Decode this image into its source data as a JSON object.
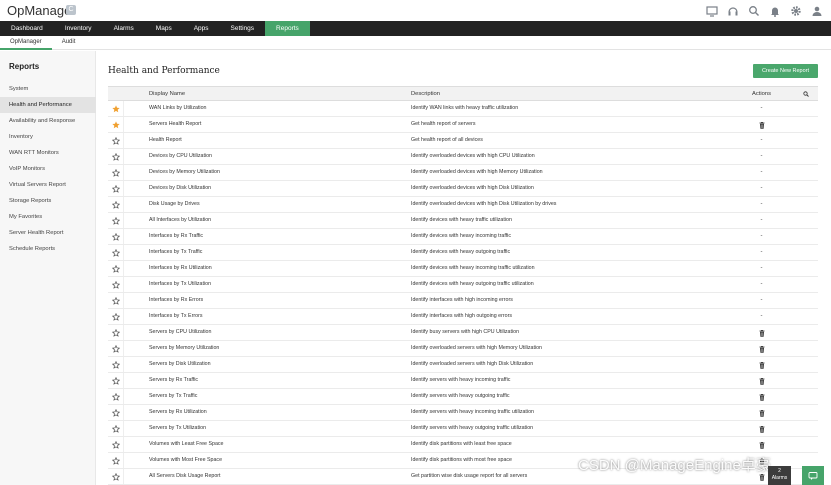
{
  "app": {
    "title": "OpManager",
    "badge": "C"
  },
  "top_icons": [
    "monitor-icon",
    "headset-icon",
    "search-icon",
    "bell-icon",
    "gear-icon",
    "user-icon"
  ],
  "nav": {
    "tabs": [
      {
        "label": "Dashboard",
        "active": false
      },
      {
        "label": "Inventory",
        "active": false
      },
      {
        "label": "Alarms",
        "active": false
      },
      {
        "label": "Maps",
        "active": false
      },
      {
        "label": "Apps",
        "active": false
      },
      {
        "label": "Settings",
        "active": false
      },
      {
        "label": "Reports",
        "active": true
      }
    ]
  },
  "subnav": {
    "tabs": [
      {
        "label": "OpManager",
        "active": true
      },
      {
        "label": "Audit",
        "active": false
      }
    ]
  },
  "sidebar": {
    "title": "Reports",
    "items": [
      {
        "label": "System",
        "active": false
      },
      {
        "label": "Health and Performance",
        "active": true
      },
      {
        "label": "Availability and Response",
        "active": false
      },
      {
        "label": "Inventory",
        "active": false
      },
      {
        "label": "WAN RTT Monitors",
        "active": false
      },
      {
        "label": "VoIP Monitors",
        "active": false
      },
      {
        "label": "Virtual Servers Report",
        "active": false
      },
      {
        "label": "Storage Reports",
        "active": false
      },
      {
        "label": "My Favorites",
        "active": false
      },
      {
        "label": "Server Health Report",
        "active": false
      },
      {
        "label": "Schedule Reports",
        "active": false
      }
    ]
  },
  "main": {
    "title": "Health and Performance",
    "create_button": "Create New Report",
    "columns": {
      "display_name": "Display Name",
      "description": "Description",
      "actions": "Actions"
    },
    "rows": [
      {
        "favorite": true,
        "name": "WAN Links by Utilization",
        "description": "Identify WAN links with heavy traffic utilization",
        "action": "-"
      },
      {
        "favorite": true,
        "name": "Servers Health Report",
        "description": "Get health report of servers",
        "action": "delete"
      },
      {
        "favorite": false,
        "name": "Health Report",
        "description": "Get health report of all devices",
        "action": "-"
      },
      {
        "favorite": false,
        "name": "Devices by CPU Utilization",
        "description": "Identify overloaded devices with high CPU Utilization",
        "action": "-"
      },
      {
        "favorite": false,
        "name": "Devices by Memory Utilization",
        "description": "Identify overloaded devices with high Memory Utilization",
        "action": "-"
      },
      {
        "favorite": false,
        "name": "Devices by Disk Utilization",
        "description": "Identify overloaded devices with high Disk Utilization",
        "action": "-"
      },
      {
        "favorite": false,
        "name": "Disk Usage by Drives",
        "description": "Identify overloaded devices with high Disk Utilization by drives",
        "action": "-"
      },
      {
        "favorite": false,
        "name": "All Interfaces by Utilization",
        "description": "Identify devices with heavy traffic utilization",
        "action": "-"
      },
      {
        "favorite": false,
        "name": "Interfaces by Rx Traffic",
        "description": "Identify devices with heavy incoming traffic",
        "action": "-"
      },
      {
        "favorite": false,
        "name": "Interfaces by Tx Traffic",
        "description": "Identify devices with heavy outgoing traffic",
        "action": "-"
      },
      {
        "favorite": false,
        "name": "Interfaces by Rx Utilization",
        "description": "Identify devices with heavy incoming traffic utilization",
        "action": "-"
      },
      {
        "favorite": false,
        "name": "Interfaces by Tx Utilization",
        "description": "Identify devices with heavy outgoing traffic utilization",
        "action": "-"
      },
      {
        "favorite": false,
        "name": "Interfaces by Rx Errors",
        "description": "Identify interfaces with high incoming errors",
        "action": "-"
      },
      {
        "favorite": false,
        "name": "Interfaces by Tx Errors",
        "description": "Identify interfaces with high outgoing errors",
        "action": "-"
      },
      {
        "favorite": false,
        "name": "Servers by CPU Utilization",
        "description": "Identify busy servers with high CPU Utilization",
        "action": "delete"
      },
      {
        "favorite": false,
        "name": "Servers by Memory Utilization",
        "description": "Identify overloaded servers with high Memory Utilization",
        "action": "delete"
      },
      {
        "favorite": false,
        "name": "Servers by Disk Utilization",
        "description": "Identify overloaded servers with high Disk Utilization",
        "action": "delete"
      },
      {
        "favorite": false,
        "name": "Servers by Rx Traffic",
        "description": "Identify servers with heavy incoming traffic",
        "action": "delete"
      },
      {
        "favorite": false,
        "name": "Servers by Tx Traffic",
        "description": "Identify servers with heavy outgoing traffic",
        "action": "delete"
      },
      {
        "favorite": false,
        "name": "Servers by Rx Utilization",
        "description": "Identify servers with heavy incoming traffic utilization",
        "action": "delete"
      },
      {
        "favorite": false,
        "name": "Servers by Tx Utilization",
        "description": "Identify servers with heavy outgoing traffic utilization",
        "action": "delete"
      },
      {
        "favorite": false,
        "name": "Volumes with Least Free Space",
        "description": "Identify disk partitions with least free space",
        "action": "delete"
      },
      {
        "favorite": false,
        "name": "Volumes with Most Free Space",
        "description": "Identify disk partitions with most free space",
        "action": "delete"
      },
      {
        "favorite": false,
        "name": "All Servers Disk Usage Report",
        "description": "Get partition wise disk usage report for all servers",
        "action": "delete"
      }
    ]
  },
  "widgets": {
    "alarms_label": "Alarms",
    "alarms_count": "2"
  },
  "watermark": "CSDN @ManageEngine卓豪",
  "colors": {
    "accent": "#46a46a",
    "star_active": "#f0a030",
    "navbar": "#222222"
  }
}
